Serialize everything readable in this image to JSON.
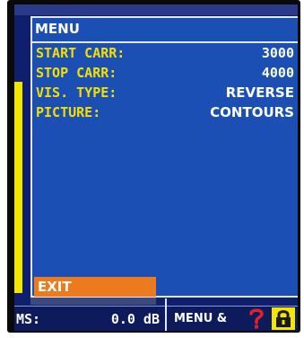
{
  "menu": {
    "title": "MENU",
    "items": [
      {
        "label": "START CARR:",
        "value": "3000"
      },
      {
        "label": "STOP CARR:",
        "value": "4000"
      },
      {
        "label": "VIS. TYPE:",
        "value": "REVERSE"
      },
      {
        "label": "PICTURE:",
        "value": "CONTOURS"
      }
    ],
    "exit_label": "EXIT"
  },
  "status": {
    "ms_label": "MS:",
    "ms_value": "0.0 dB",
    "menu_label": "MENU &",
    "help_icon": "question-mark-icon",
    "lock_icon": "lock-icon"
  },
  "colors": {
    "screen_bg": "#0f1f6e",
    "panel_bg": "#1b4fb4",
    "label": "#f4e000",
    "value": "#ffffff",
    "exit_bg": "#ec7a1e",
    "help": "#e0202a",
    "lock_bg": "#f2e600"
  }
}
